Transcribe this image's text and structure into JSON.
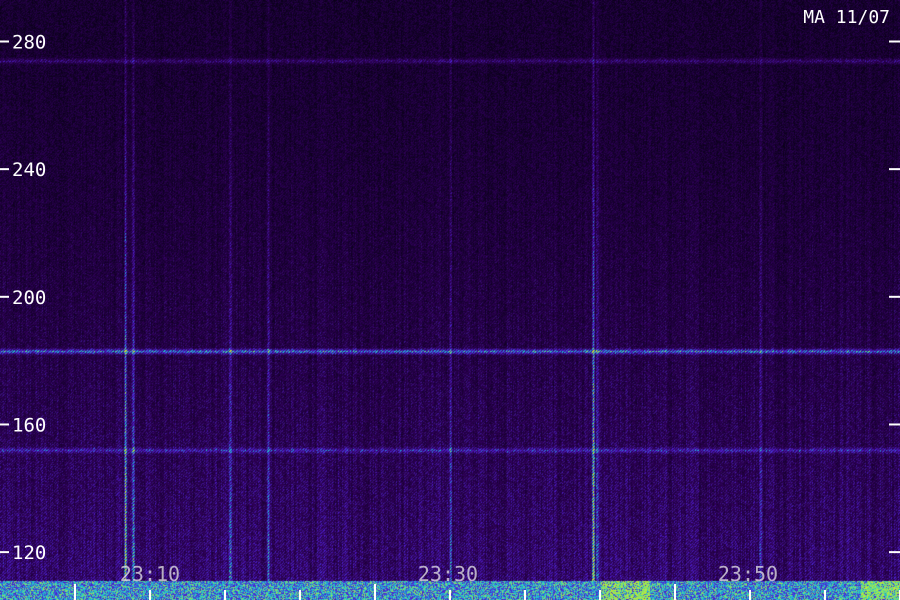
{
  "station_label": "MA 11/07",
  "chart_data": {
    "type": "heatmap",
    "title": "",
    "xlabel": "",
    "ylabel": "",
    "y_ticks": [
      280,
      240,
      200,
      160,
      120
    ],
    "y_tick_labels": [
      "280",
      "240",
      "200",
      "160",
      "120"
    ],
    "ylim": [
      105,
      293
    ],
    "x_tick_labels": [
      "23:10",
      "23:30",
      "23:50"
    ],
    "colors": {
      "background": "#000000",
      "low": "#2a0a4e",
      "mid": "#5a1fc8",
      "high": "#1fc8d8",
      "peak": "#c8e81f"
    },
    "features": [
      {
        "kind": "horizontal_band",
        "y": 183,
        "intensity": "medium"
      },
      {
        "kind": "horizontal_band",
        "y": 274,
        "intensity": "low"
      },
      {
        "kind": "horizontal_band",
        "y": 152,
        "intensity": "low"
      },
      {
        "kind": "bright_bottom_band",
        "y_range": [
          105,
          111
        ],
        "intensity": "high"
      }
    ]
  }
}
